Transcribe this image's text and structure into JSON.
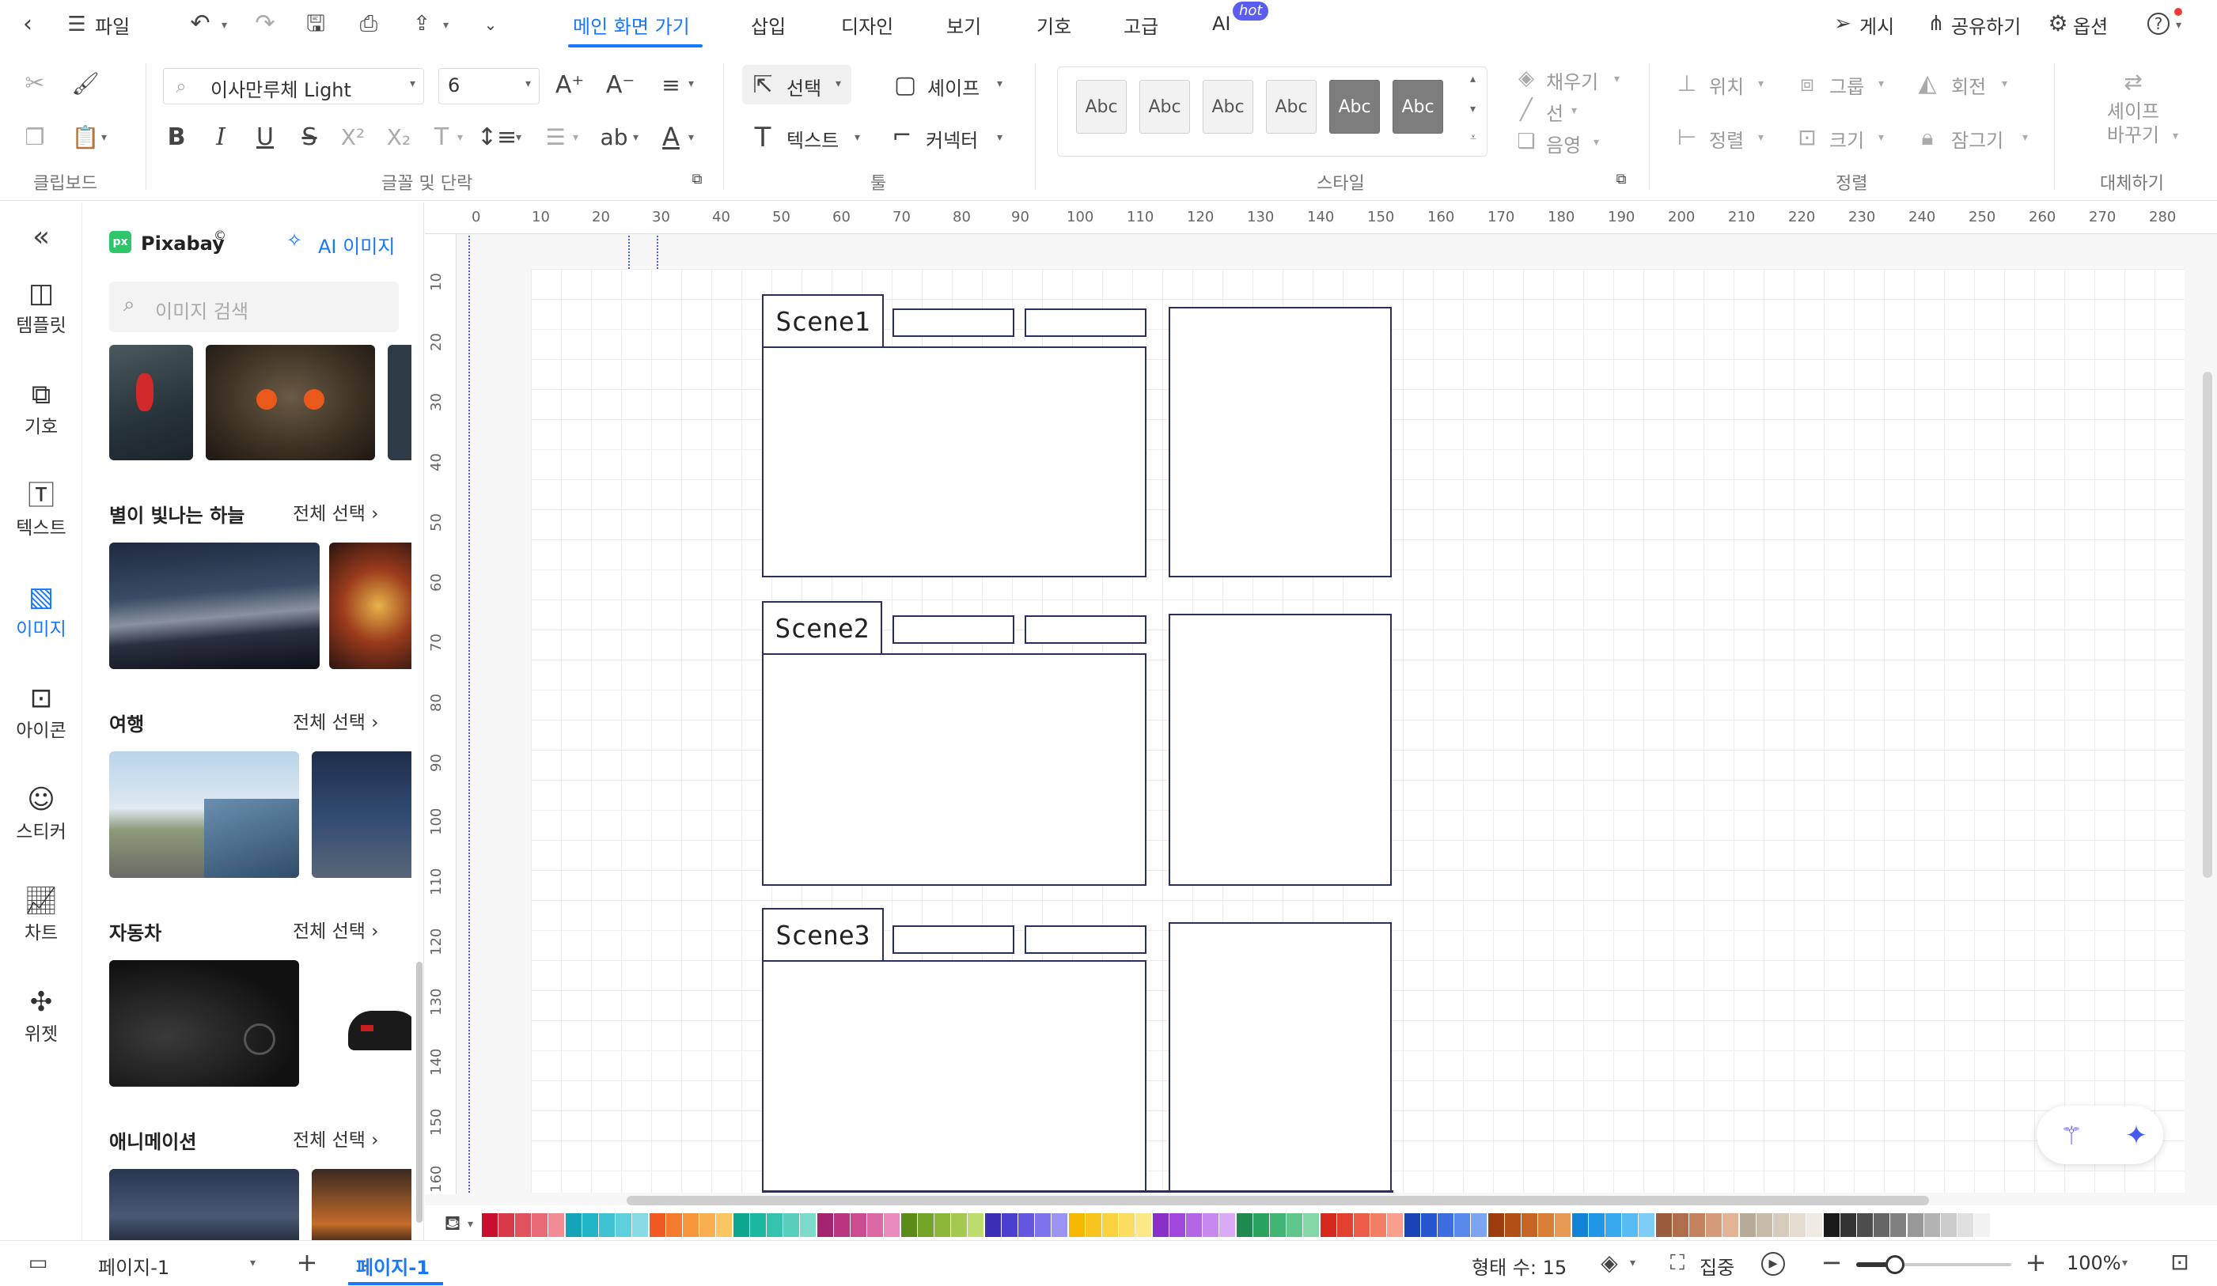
{
  "menubar": {
    "file": "파일",
    "tabs": [
      "메인 화면 가기",
      "삽입",
      "디자인",
      "보기",
      "기호",
      "고급",
      "AI"
    ],
    "ai_badge": "hot",
    "publish": "게시",
    "share": "공유하기",
    "options": "옵션"
  },
  "ribbon": {
    "font_name": "이사만루체 Light",
    "font_size": "6",
    "select": "선택",
    "shape": "셰이프",
    "text": "텍스트",
    "connector": "커넥터",
    "style_swatch": "Abc",
    "fill": "채우기",
    "line": "선",
    "shadow": "음영",
    "position": "위치",
    "group": "그룹",
    "rotate": "회전",
    "align": "정렬",
    "size": "크기",
    "lock": "잠그기",
    "replace_shape": "셰이프\n바꾸기",
    "groups": {
      "clipboard": "클립보드",
      "font": "글꼴 및 단락",
      "tools": "툴",
      "style": "스타일",
      "arrange": "정렬",
      "replace": "대체하기"
    }
  },
  "rail": {
    "items": [
      {
        "label": "템플릿",
        "icon": "template-icon"
      },
      {
        "label": "기호",
        "icon": "symbol-icon"
      },
      {
        "label": "텍스트",
        "icon": "text-icon"
      },
      {
        "label": "이미지",
        "icon": "image-icon"
      },
      {
        "label": "아이콘",
        "icon": "icon-icon"
      },
      {
        "label": "스티커",
        "icon": "sticker-icon"
      },
      {
        "label": "차트",
        "icon": "chart-icon"
      },
      {
        "label": "위젯",
        "icon": "widget-icon"
      }
    ]
  },
  "panel": {
    "brand": "Pixabay",
    "brand_mark": "©",
    "ai_image": "AI 이미지",
    "search_placeholder": "이미지 검색",
    "select_all": "전체 선택",
    "sections": [
      "별이 빛나는 하늘",
      "여행",
      "자동차",
      "애니메이션"
    ]
  },
  "ruler": {
    "top": [
      "0",
      "10",
      "20",
      "30",
      "40",
      "50",
      "60",
      "70",
      "80",
      "90",
      "100",
      "110",
      "120",
      "130",
      "140",
      "150",
      "160",
      "170",
      "180",
      "190",
      "200",
      "210",
      "220",
      "230",
      "240",
      "250",
      "260",
      "270",
      "280"
    ],
    "left": [
      "10",
      "20",
      "30",
      "40",
      "50",
      "60",
      "70",
      "80",
      "90",
      "100",
      "110",
      "120",
      "130",
      "140",
      "150",
      "160"
    ]
  },
  "canvas": {
    "scenes": [
      "Scene1",
      "Scene2",
      "Scene3"
    ]
  },
  "colors": {
    "accent": "#1677ff",
    "shape_stroke": "#2b2f5e",
    "palette": [
      "#c8102e",
      "#d93a49",
      "#e0525d",
      "#e86a76",
      "#f08a95",
      "#16a2b8",
      "#22b5c9",
      "#3fc3d4",
      "#5ecfdc",
      "#86dbe5",
      "#f05a22",
      "#f47a2e",
      "#f7963d",
      "#f9af4f",
      "#fbc562",
      "#0da68f",
      "#1bb79e",
      "#36c3ad",
      "#57cfbc",
      "#7ddbcb",
      "#a3246f",
      "#b9357f",
      "#cc4c91",
      "#dc68a5",
      "#e98bbc",
      "#5b8c1a",
      "#73a427",
      "#8cb83a",
      "#a5c950",
      "#bedb6e",
      "#3b2fb6",
      "#4b3fd0",
      "#6357e0",
      "#7d73ea",
      "#9b93f1",
      "#f5b700",
      "#f8c51f",
      "#fad23f",
      "#fcdd62",
      "#fde888",
      "#8a2fc7",
      "#a048db",
      "#b466e6",
      "#c788ef",
      "#d9aaf5",
      "#1e8a4f",
      "#2aa260",
      "#40b574",
      "#5fc78c",
      "#84d7a8",
      "#d6281e",
      "#e2412f",
      "#ec5e47",
      "#f37e66",
      "#f8a08b",
      "#1a43b8",
      "#2756d1",
      "#3d6de0",
      "#5a88ea",
      "#7da4f1",
      "#9c3d0d",
      "#b24f17",
      "#c66524",
      "#d87e37",
      "#e79a53",
      "#1383d6",
      "#1f97e6",
      "#38a9ee",
      "#58bbf3",
      "#7ecdf7",
      "#9b5a3c",
      "#b06d4c",
      "#c4825f",
      "#d59a78",
      "#e3b395",
      "#b7ab98",
      "#c7bcaa",
      "#d6ccbc",
      "#e3dccf",
      "#efebe4",
      "#1a1a1a",
      "#333333",
      "#4d4d4d",
      "#666666",
      "#808080",
      "#999999",
      "#b3b3b3",
      "#cccccc",
      "#e0e0e0",
      "#f2f2f2"
    ]
  },
  "status": {
    "page_select": "페이지-1",
    "page_tab": "페이지-1",
    "shape_count": "형태 수: 15",
    "focus": "집중",
    "zoom": "100%"
  }
}
